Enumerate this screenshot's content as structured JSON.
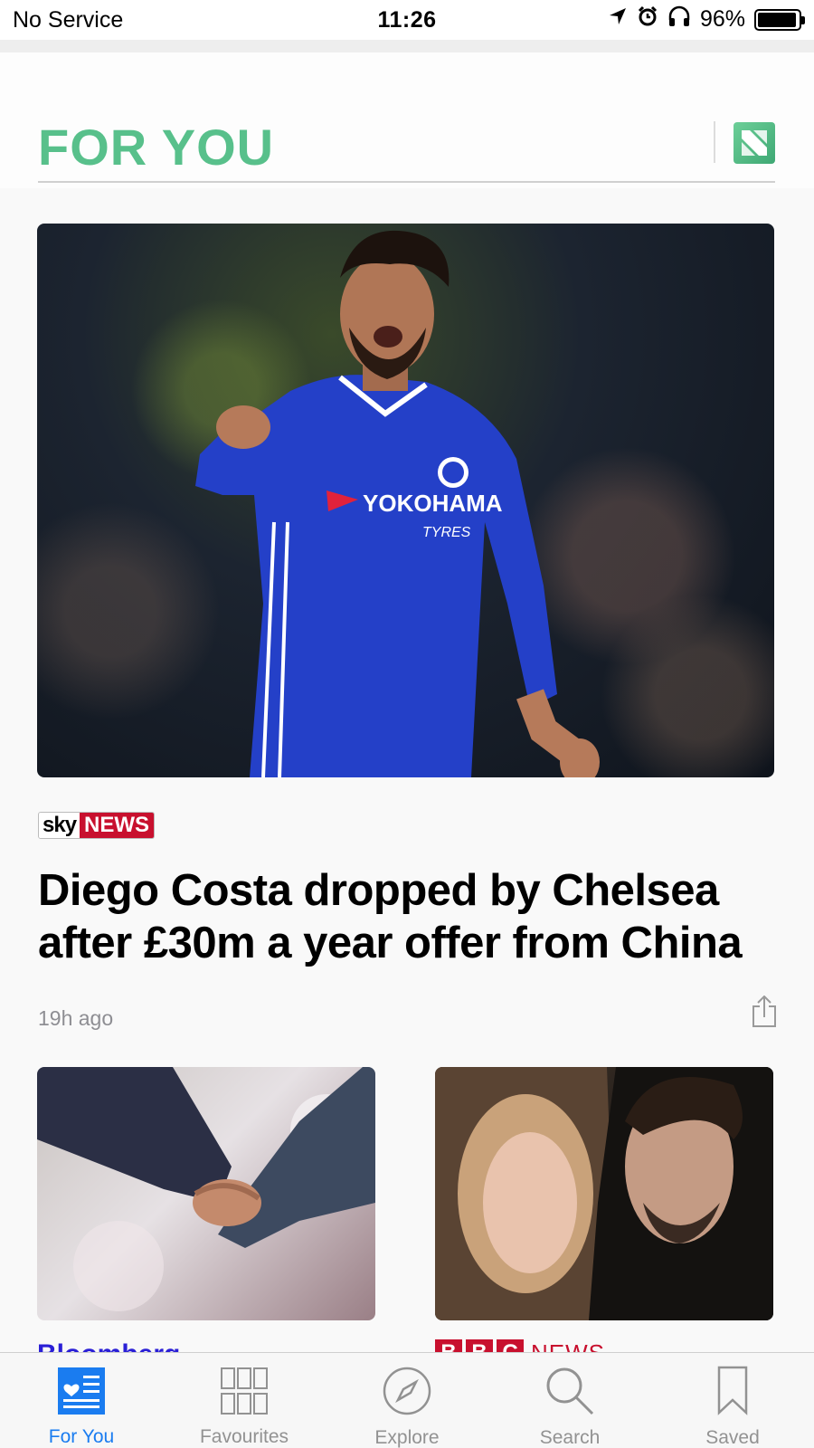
{
  "status_bar": {
    "carrier": "No Service",
    "time": "11:26",
    "battery": "96%",
    "battery_level": 0.96,
    "icons": [
      "location-icon",
      "alarm-icon",
      "headphones-icon",
      "battery-icon"
    ]
  },
  "header": {
    "title": "FOR YOU",
    "title_color": "#58c08b",
    "logo_icon": "apple-news-icon"
  },
  "hero": {
    "source": {
      "sky": "sky",
      "news": "NEWS"
    },
    "headline": "Diego Costa dropped by Chelsea after £30m a year offer from China",
    "timestamp": "19h ago",
    "share_icon": "share-icon",
    "shirt_text": {
      "sponsor": "YOKOHAMA",
      "sub": "TYRES"
    }
  },
  "cards": [
    {
      "source": "Bloomberg",
      "image": "handshake-image"
    },
    {
      "source": "BBC NEWS",
      "bbc_letters": [
        "B",
        "B",
        "C"
      ],
      "news_label": "NEWS",
      "image": "couple-image"
    }
  ],
  "tab_bar": {
    "active_color": "#1a7cf0",
    "inactive_color": "#929292",
    "tabs": [
      {
        "label": "For You",
        "icon": "for-you-icon",
        "active": true
      },
      {
        "label": "Favourites",
        "icon": "favourites-icon",
        "active": false
      },
      {
        "label": "Explore",
        "icon": "compass-icon",
        "active": false
      },
      {
        "label": "Search",
        "icon": "search-icon",
        "active": false
      },
      {
        "label": "Saved",
        "icon": "bookmark-icon",
        "active": false
      }
    ]
  }
}
